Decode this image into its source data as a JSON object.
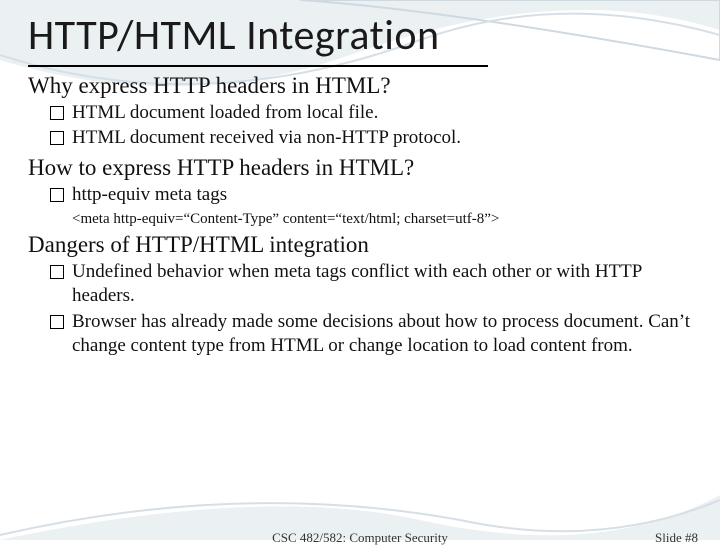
{
  "title": "HTTP/HTML Integration",
  "sections": {
    "why": {
      "heading": "Why express HTTP headers in HTML?",
      "items": [
        "HTML document loaded from local file.",
        "HTML document received via non-HTTP protocol."
      ]
    },
    "how": {
      "heading": "How to express HTTP headers in HTML?",
      "items": [
        "http-equiv meta tags"
      ],
      "code": "<meta http-equiv=“Content-Type” content=“text/html; charset=utf-8”>"
    },
    "dangers": {
      "heading": "Dangers of HTTP/HTML integration",
      "items": [
        "Undefined behavior when meta tags conflict with each other or with HTTP headers.",
        "Browser has already made some decisions about how to process document.  Can’t change content type from HTML or change location to load content from."
      ]
    }
  },
  "footer": {
    "course": "CSC 482/582: Computer Security",
    "slide": "Slide #8"
  }
}
